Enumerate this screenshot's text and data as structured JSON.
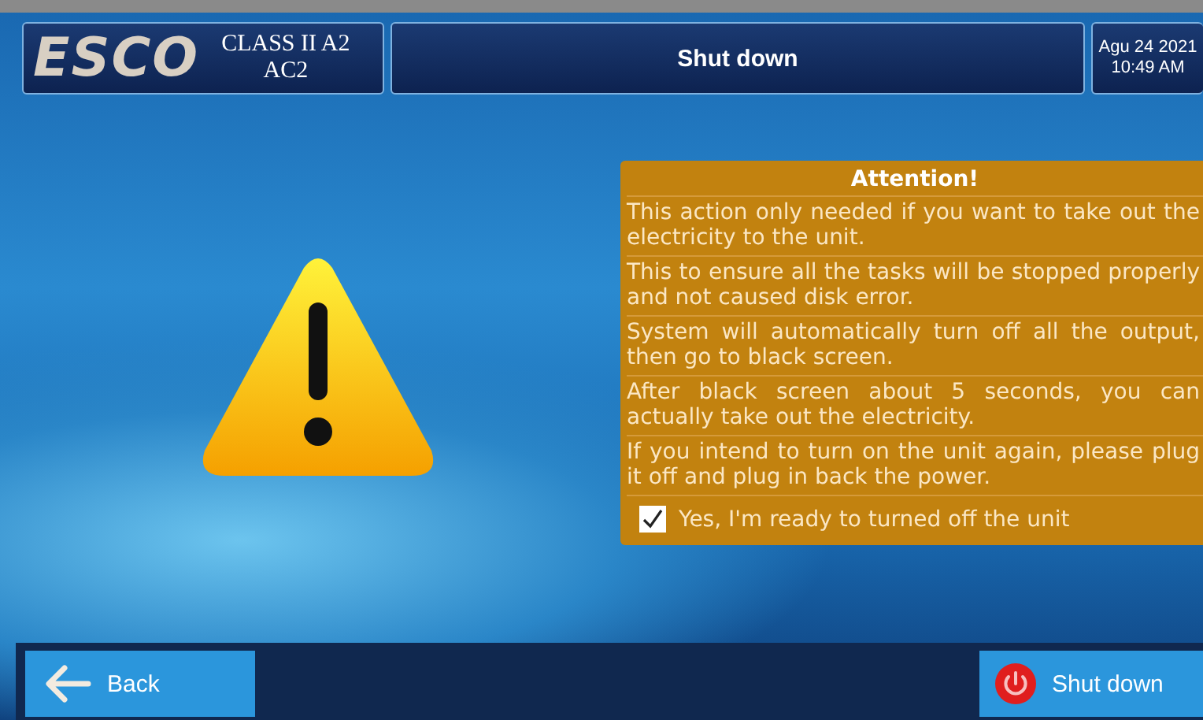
{
  "header": {
    "logo": "ESCO",
    "model": [
      "CLASS II A2",
      "AC2"
    ],
    "title": "Shut down",
    "date": "Agu 24 2021",
    "time": "10:49 AM"
  },
  "attention": {
    "title": "Attention!",
    "paragraphs": [
      "This action only needed if you want to take out the electricity to the unit.",
      "This to ensure all the tasks will be stopped properly and not caused disk error.",
      "System will automatically turn off all the output, then go to black screen.",
      "After black screen about 5 seconds, you can actually take out the electricity.",
      "If you intend to turn on the unit again, please plug it off and plug in back the power."
    ],
    "confirm": {
      "label": "Yes, I'm ready to turned off the unit",
      "checked": true
    }
  },
  "footer": {
    "back": "Back",
    "shutdown": "Shut down"
  }
}
